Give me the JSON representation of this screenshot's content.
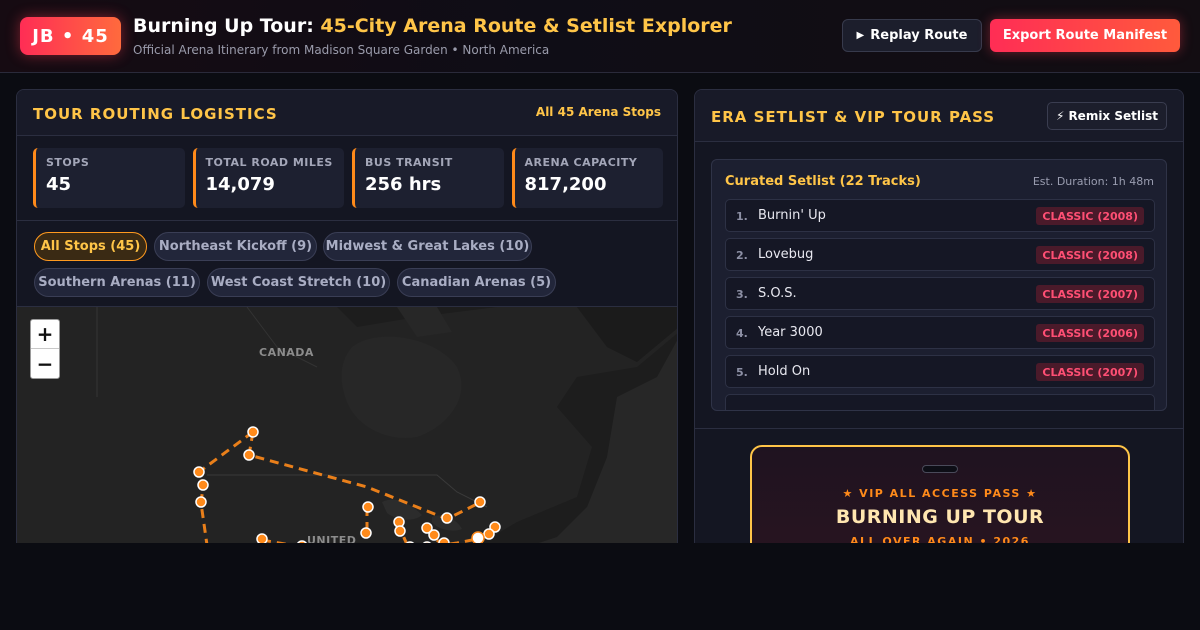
{
  "header": {
    "badge": "JB • 45",
    "title_main": "Burning Up Tour: ",
    "title_accent": "45-City Arena Route & Setlist Explorer",
    "subtitle": "Official Arena Itinerary from Madison Square Garden • North America",
    "replay_icon": "▶",
    "replay_label": "Replay Route",
    "export_label": "Export Route Manifest"
  },
  "routing": {
    "title": "TOUR ROUTING LOGISTICS",
    "meta": "All 45 Arena Stops",
    "stats": [
      {
        "label": "STOPS",
        "value": "45"
      },
      {
        "label": "TOTAL ROAD MILES",
        "value": "14,079"
      },
      {
        "label": "BUS TRANSIT",
        "value": "256 hrs"
      },
      {
        "label": "ARENA CAPACITY",
        "value": "817,200"
      }
    ],
    "filters": [
      {
        "label": "All Stops (45)",
        "active": true
      },
      {
        "label": "Northeast Kickoff (9)",
        "active": false
      },
      {
        "label": "Midwest & Great Lakes (10)",
        "active": false
      },
      {
        "label": "Southern Arenas (11)",
        "active": false
      },
      {
        "label": "West Coast Stretch (10)",
        "active": false
      },
      {
        "label": "Canadian Arenas (5)",
        "active": false
      }
    ],
    "map": {
      "zoom_in": "+",
      "zoom_out": "−",
      "label_canada": "CANADA",
      "label_us": "UNITED",
      "route_color": "#ff8a1a"
    }
  },
  "setlist": {
    "title": "ERA SETLIST & VIP TOUR PASS",
    "remix_icon": "⚡",
    "remix_label": "Remix Setlist",
    "box_title": "Curated Setlist (22 Tracks)",
    "duration": "Est. Duration: 1h 48m",
    "tracks": [
      {
        "num": "1.",
        "name": "Burnin' Up",
        "badge": "CLASSIC (2008)"
      },
      {
        "num": "2.",
        "name": "Lovebug",
        "badge": "CLASSIC (2008)"
      },
      {
        "num": "3.",
        "name": "S.O.S.",
        "badge": "CLASSIC (2007)"
      },
      {
        "num": "4.",
        "name": "Year 3000",
        "badge": "CLASSIC (2006)"
      },
      {
        "num": "5.",
        "name": "Hold On",
        "badge": "CLASSIC (2007)"
      }
    ]
  },
  "pass": {
    "kicker": "★ VIP ALL ACCESS PASS ★",
    "title": "BURNING UP TOUR",
    "sub": "ALL OVER AGAIN • 2026"
  }
}
